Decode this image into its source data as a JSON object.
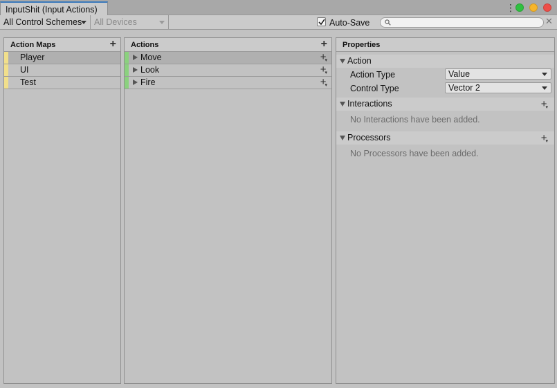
{
  "window": {
    "tab_title": "InputShit (Input Actions)",
    "controls": [
      {
        "name": "green-window-button",
        "color": "#2fc140"
      },
      {
        "name": "yellow-window-button",
        "color": "#f7b52a"
      },
      {
        "name": "red-window-button",
        "color": "#ee4e48"
      }
    ]
  },
  "toolbar": {
    "control_schemes": "All Control Schemes",
    "devices": "All Devices",
    "autosave_label": "Auto-Save",
    "autosave_checked": true,
    "search_placeholder": "",
    "clear_glyph": "✕"
  },
  "action_maps": {
    "header": "Action Maps",
    "add_glyph": "+",
    "strip_color": "#f1df8b",
    "items": [
      {
        "label": "Player",
        "selected": true
      },
      {
        "label": "UI",
        "selected": false
      },
      {
        "label": "Test",
        "selected": false
      }
    ]
  },
  "actions": {
    "header": "Actions",
    "add_glyph": "+",
    "strip_color": "#8bd17e",
    "items": [
      {
        "label": "Move",
        "selected": true
      },
      {
        "label": "Look",
        "selected": false
      },
      {
        "label": "Fire",
        "selected": false
      }
    ]
  },
  "properties": {
    "header": "Properties",
    "action_section": "Action",
    "action_type_label": "Action Type",
    "action_type_value": "Value",
    "control_type_label": "Control Type",
    "control_type_value": "Vector 2",
    "interactions_section": "Interactions",
    "interactions_empty": "No Interactions have been added.",
    "processors_section": "Processors",
    "processors_empty": "No Processors have been added."
  }
}
